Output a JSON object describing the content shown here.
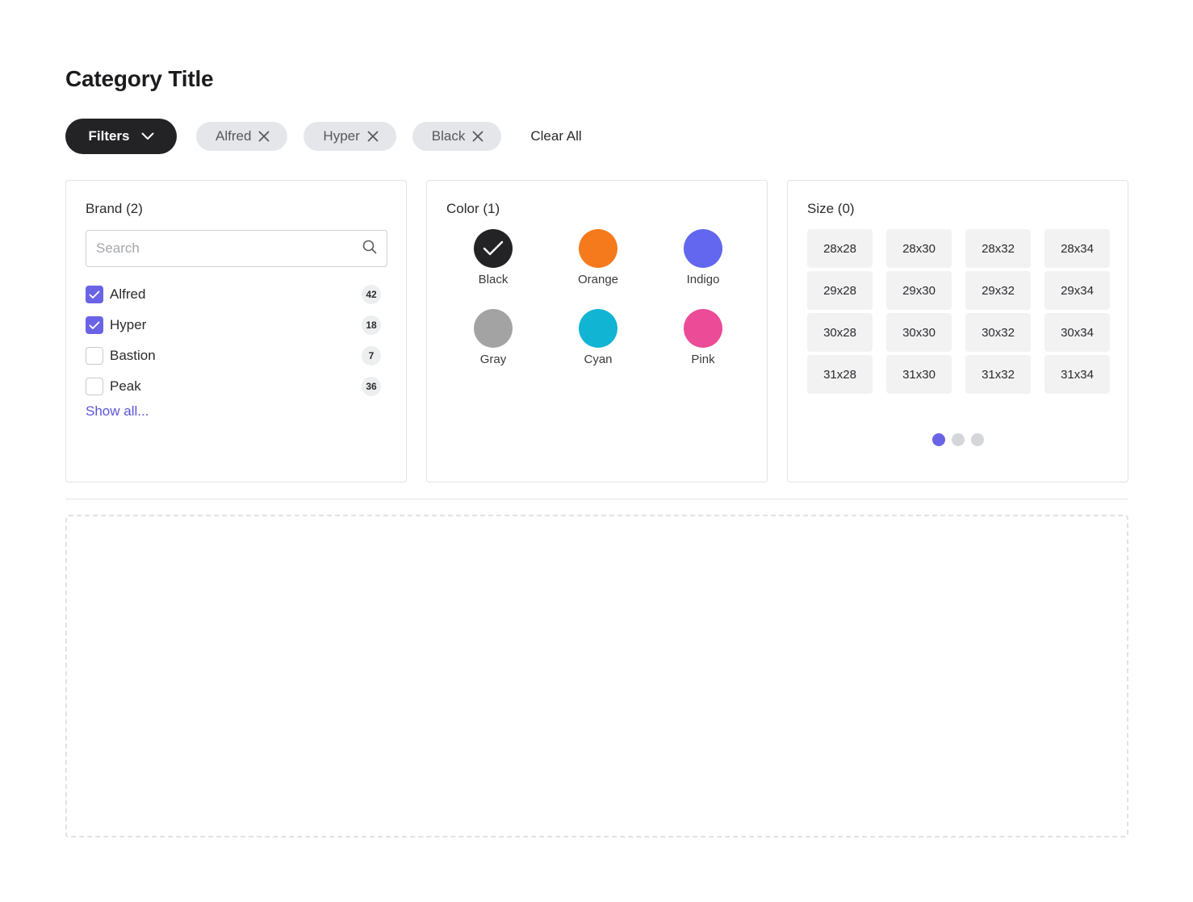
{
  "page": {
    "title": "Category Title"
  },
  "filter_bar": {
    "filters_label": "Filters",
    "active_chips": [
      "Alfred",
      "Hyper",
      "Black"
    ],
    "clear_all_label": "Clear All"
  },
  "brand": {
    "title": "Brand (2)",
    "search_placeholder": "Search",
    "items": [
      {
        "label": "Alfred",
        "count": "42",
        "checked": true
      },
      {
        "label": "Hyper",
        "count": "18",
        "checked": true
      },
      {
        "label": "Bastion",
        "count": "7",
        "checked": false
      },
      {
        "label": "Peak",
        "count": "36",
        "checked": false
      }
    ],
    "show_all_label": "Show all..."
  },
  "color": {
    "title": "Color (1)",
    "swatches": [
      {
        "label": "Black",
        "hex": "#232325",
        "selected": true
      },
      {
        "label": "Orange",
        "hex": "#f57a1c",
        "selected": false
      },
      {
        "label": "Indigo",
        "hex": "#6366ee",
        "selected": false
      },
      {
        "label": "Gray",
        "hex": "#a3a3a3",
        "selected": false
      },
      {
        "label": "Cyan",
        "hex": "#11b4d3",
        "selected": false
      },
      {
        "label": "Pink",
        "hex": "#eb4b97",
        "selected": false
      }
    ]
  },
  "size": {
    "title": "Size (0)",
    "options": [
      "28x28",
      "28x30",
      "28x32",
      "28x34",
      "29x28",
      "29x30",
      "29x32",
      "29x34",
      "30x28",
      "30x30",
      "30x32",
      "30x34",
      "31x28",
      "31x30",
      "31x32",
      "31x34"
    ],
    "pager_pages": 3,
    "pager_active": 1
  },
  "colors": {
    "accent": "#6b63e6",
    "dark": "#232325",
    "chip_bg": "#e4e6e9"
  }
}
